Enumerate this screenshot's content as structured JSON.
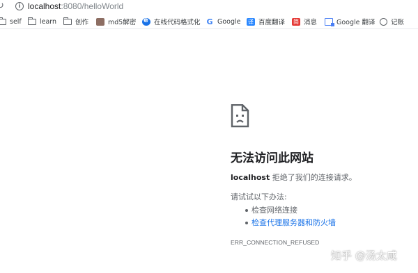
{
  "browser": {
    "url_host": "localhost",
    "url_path": ":8080/helloWorld"
  },
  "bookmarks": [
    {
      "label": "self",
      "icon": "folder-icon"
    },
    {
      "label": "learn",
      "icon": "folder-icon"
    },
    {
      "label": "创作",
      "icon": "folder-icon"
    },
    {
      "label": "md5解密",
      "icon": "md5-icon"
    },
    {
      "label": "在线代码格式化",
      "icon": "code-format-icon"
    },
    {
      "label": "Google",
      "icon": "google-icon"
    },
    {
      "label": "百度翻译",
      "icon": "baidu-translate-icon"
    },
    {
      "label": "消息",
      "icon": "jianshu-icon"
    },
    {
      "label": "Google 翻译",
      "icon": "google-translate-icon"
    },
    {
      "label": "记账",
      "icon": "globe-icon"
    }
  ],
  "error": {
    "title": "无法访问此网站",
    "host": "localhost",
    "description": " 拒绝了我们的连接请求。",
    "try_label": "请试试以下办法:",
    "suggestions": [
      {
        "text": "检查网络连接"
      },
      {
        "text": "检查代理服务器和防火墙"
      }
    ],
    "code": "ERR_CONNECTION_REFUSED"
  },
  "watermark": "知乎 @汤太咸",
  "colors": {
    "link": "#1a73e8",
    "text": "#202124",
    "secondary": "#5f6368"
  }
}
